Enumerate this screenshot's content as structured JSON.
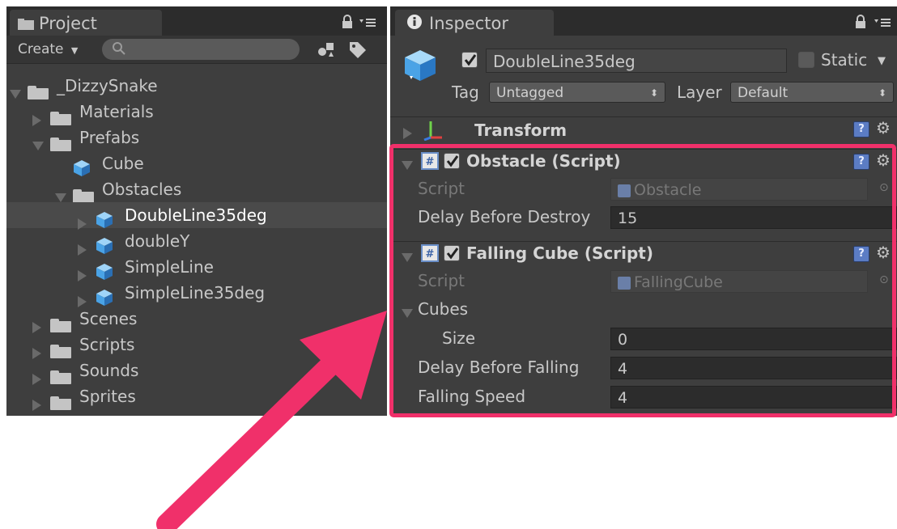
{
  "project": {
    "tab_label": "Project",
    "create_label": "Create",
    "search_placeholder": "",
    "tree": [
      {
        "label": "_DizzySnake",
        "depth": 0,
        "expander": "down",
        "icon": "folder"
      },
      {
        "label": "Materials",
        "depth": 1,
        "expander": "right",
        "icon": "folder"
      },
      {
        "label": "Prefabs",
        "depth": 1,
        "expander": "down",
        "icon": "folder"
      },
      {
        "label": "Cube",
        "depth": 2,
        "expander": "none",
        "icon": "cube"
      },
      {
        "label": "Obstacles",
        "depth": 2,
        "expander": "down",
        "icon": "folder"
      },
      {
        "label": "DoubleLine35deg",
        "depth": 3,
        "expander": "right",
        "icon": "cube",
        "selected": true
      },
      {
        "label": "doubleY",
        "depth": 3,
        "expander": "right",
        "icon": "cube"
      },
      {
        "label": "SimpleLine",
        "depth": 3,
        "expander": "right",
        "icon": "cube"
      },
      {
        "label": "SimpleLine35deg",
        "depth": 3,
        "expander": "right",
        "icon": "cube"
      },
      {
        "label": "Scenes",
        "depth": 1,
        "expander": "right",
        "icon": "folder"
      },
      {
        "label": "Scripts",
        "depth": 1,
        "expander": "right",
        "icon": "folder"
      },
      {
        "label": "Sounds",
        "depth": 1,
        "expander": "right",
        "icon": "folder"
      },
      {
        "label": "Sprites",
        "depth": 1,
        "expander": "right",
        "icon": "folder"
      }
    ]
  },
  "inspector": {
    "tab_label": "Inspector",
    "object_name": "DoubleLine35deg",
    "static_label": "Static",
    "tag_label": "Tag",
    "tag_value": "Untagged",
    "layer_label": "Layer",
    "layer_value": "Default",
    "transform_label": "Transform",
    "obstacle": {
      "title": "Obstacle (Script)",
      "script_label": "Script",
      "script_value": "Obstacle",
      "delay_label": "Delay Before Destroy",
      "delay_value": "15"
    },
    "falling": {
      "title": "Falling Cube (Script)",
      "script_label": "Script",
      "script_value": "FallingCube",
      "cubes_label": "Cubes",
      "size_label": "Size",
      "size_value": "0",
      "delay_label": "Delay Before Falling",
      "delay_value": "4",
      "speed_label": "Falling Speed",
      "speed_value": "4"
    }
  },
  "colors": {
    "highlight": "#f0306a",
    "panel": "#3e3e3e",
    "selected_row": "#4a4a4a",
    "cube_light": "#9fd4f8",
    "cube_mid": "#4aa3e6",
    "cube_dark": "#2a6fb4"
  }
}
